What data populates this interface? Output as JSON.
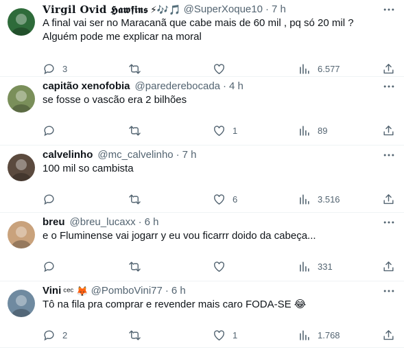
{
  "tweets": [
    {
      "display_name": "𝐕𝐢𝐫𝐠𝐢𝐥 𝐎𝐯𝐢𝐝 𝕳𝖆𝖜𝖋𝖎𝖓𝖘",
      "name_emojis": "⚡🎶🎵",
      "handle": "@SuperXoque10",
      "separator": "·",
      "time": "7 h",
      "text_lines": [
        "A final vai ser no Maracanã que cabe mais de 60 mil , pq só 20 mil ?",
        "Alguém pode me explicar na moral"
      ],
      "replies": "3",
      "retweets": "",
      "likes": "",
      "views": "6.577",
      "avatar_color": "#2e6b3a"
    },
    {
      "display_name": "capitão xenofobia",
      "name_emojis": "",
      "handle": "@paredereboc ada",
      "separator": "·",
      "time": "4 h",
      "text_lines": [
        "se fosse o vascão era 2 bilhões"
      ],
      "replies": "",
      "retweets": "",
      "likes": "1",
      "views": "89",
      "avatar_color": "#7a8f5a"
    },
    {
      "display_name": "calvelinho",
      "name_emojis": "",
      "handle": "@mc_calvelinho",
      "separator": "·",
      "time": "7 h",
      "text_lines": [
        "100 mil so cambista"
      ],
      "replies": "",
      "retweets": "",
      "likes": "6",
      "views": "3.516",
      "avatar_color": "#5b4a3e"
    },
    {
      "display_name": "breu",
      "name_emojis": "",
      "handle": "@breu_lucaxx",
      "separator": "·",
      "time": "6 h",
      "text_lines": [
        "e o Fluminense vai jogarr y eu vou ficarrr doido da cabeça..."
      ],
      "replies": "",
      "retweets": "",
      "likes": "",
      "views": "331",
      "avatar_color": "#c9a27c"
    },
    {
      "display_name": "Vini",
      "name_emojis": "ᶜᵉᶜ 🦊",
      "handle": "@PomboVini77",
      "separator": "·",
      "time": "6 h",
      "text_lines": [
        "Tô na fila pra comprar e revender mais caro FODA-SE 😂"
      ],
      "replies": "2",
      "retweets": "",
      "likes": "1",
      "views": "1.768",
      "avatar_color": "#6f8aa0"
    }
  ],
  "icons": {
    "reply": "reply-icon",
    "retweet": "retweet-icon",
    "like": "heart-icon",
    "views": "views-icon",
    "share": "share-icon",
    "more": "more-icon"
  },
  "colors": {
    "text": "#0f1419",
    "secondary": "#536471",
    "divider": "#eff3f4"
  }
}
